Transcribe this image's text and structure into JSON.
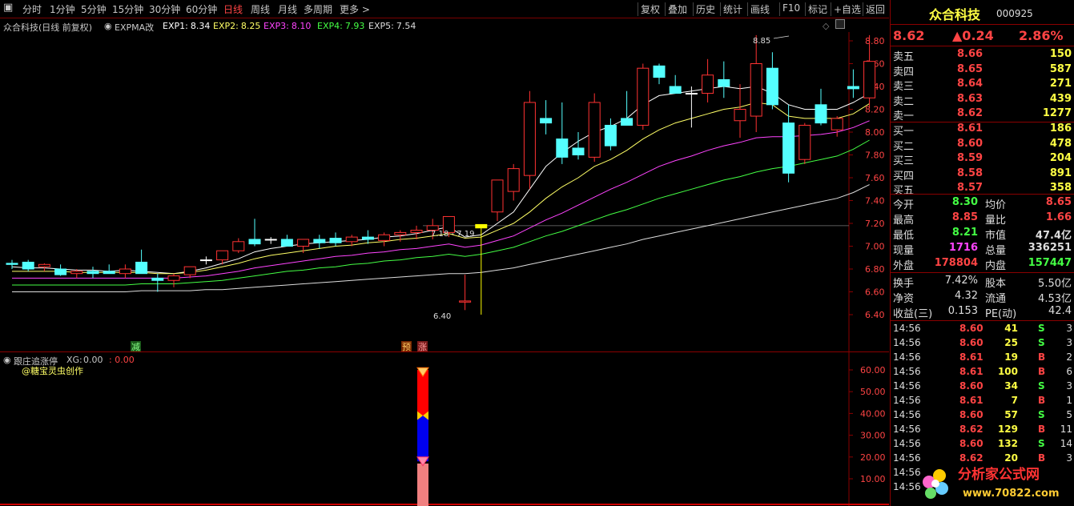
{
  "toolbar": {
    "periods": [
      "分时",
      "1分钟",
      "5分钟",
      "15分钟",
      "30分钟",
      "60分钟",
      "日线",
      "周线",
      "月线",
      "多周期",
      "更多 >"
    ],
    "active_period": "日线",
    "right_buttons": [
      "复权",
      "叠加",
      "历史",
      "统计",
      "画线",
      "F10",
      "标记",
      "+自选",
      "返回"
    ]
  },
  "main_chart": {
    "title": "众合科技(日线 前复权)",
    "indicator": "EXPMA改",
    "exps": [
      {
        "label": "EXP1:",
        "value": "8.34",
        "color": "#ffffff"
      },
      {
        "label": "EXP2:",
        "value": "8.25",
        "color": "#ffff66"
      },
      {
        "label": "EXP3:",
        "value": "8.10",
        "color": "#ff44ff"
      },
      {
        "label": "EXP4:",
        "value": "7.93",
        "color": "#44ff44"
      },
      {
        "label": "EXP5:",
        "value": "7.54",
        "color": "#dddddd"
      }
    ],
    "price_axis": [
      "8.80",
      "8.60",
      "8.40",
      "8.20",
      "8.00",
      "7.80",
      "7.60",
      "7.40",
      "7.20",
      "7.00",
      "6.80",
      "6.60",
      "6.40"
    ],
    "annotations": {
      "high_label": "8.85",
      "range_label": "7.18 - 7.19",
      "low_label": "6.40",
      "signal_jian": "减",
      "signal_yu": "预",
      "signal_zhang": "涨"
    }
  },
  "sub_chart": {
    "title": "跟庄追涨停",
    "xg_label": "XG:",
    "xg_value": "0.00",
    "xg_value2": "0.00",
    "credit": "@糖宝灵虫创作",
    "axis": [
      "60.00",
      "50.00",
      "40.00",
      "30.00",
      "20.00",
      "10.00"
    ]
  },
  "chart_data": {
    "type": "candlestick",
    "title": "众合科技(日线 前复权)",
    "ylim": [
      6.4,
      8.85
    ],
    "candles": [
      {
        "o": 6.85,
        "h": 6.88,
        "l": 6.8,
        "c": 6.84
      },
      {
        "o": 6.86,
        "h": 6.88,
        "l": 6.78,
        "c": 6.8
      },
      {
        "o": 6.82,
        "h": 6.85,
        "l": 6.78,
        "c": 6.84
      },
      {
        "o": 6.8,
        "h": 6.84,
        "l": 6.74,
        "c": 6.75
      },
      {
        "o": 6.76,
        "h": 6.8,
        "l": 6.72,
        "c": 6.78
      },
      {
        "o": 6.78,
        "h": 6.82,
        "l": 6.72,
        "c": 6.76
      },
      {
        "o": 6.78,
        "h": 6.84,
        "l": 6.76,
        "c": 6.76
      },
      {
        "o": 6.76,
        "h": 6.84,
        "l": 6.72,
        "c": 6.8
      },
      {
        "o": 6.86,
        "h": 6.97,
        "l": 6.8,
        "c": 6.76
      },
      {
        "o": 6.72,
        "h": 6.76,
        "l": 6.6,
        "c": 6.7
      },
      {
        "o": 6.7,
        "h": 6.76,
        "l": 6.64,
        "c": 6.74
      },
      {
        "o": 6.75,
        "h": 6.82,
        "l": 6.72,
        "c": 6.82
      },
      {
        "o": 6.88,
        "h": 6.91,
        "l": 6.84,
        "c": 6.88
      },
      {
        "o": 6.88,
        "h": 6.94,
        "l": 6.84,
        "c": 6.96
      },
      {
        "o": 6.96,
        "h": 7.07,
        "l": 6.94,
        "c": 7.04
      },
      {
        "o": 7.06,
        "h": 7.24,
        "l": 7.0,
        "c": 7.02
      },
      {
        "o": 7.06,
        "h": 7.08,
        "l": 7.02,
        "c": 7.06
      },
      {
        "o": 7.06,
        "h": 7.1,
        "l": 7.0,
        "c": 7.0
      },
      {
        "o": 7.0,
        "h": 7.06,
        "l": 6.94,
        "c": 7.06
      },
      {
        "o": 7.06,
        "h": 7.1,
        "l": 6.98,
        "c": 7.03
      },
      {
        "o": 7.07,
        "h": 7.12,
        "l": 7.0,
        "c": 7.03
      },
      {
        "o": 7.04,
        "h": 7.1,
        "l": 7.0,
        "c": 7.08
      },
      {
        "o": 7.08,
        "h": 7.14,
        "l": 7.02,
        "c": 7.06
      },
      {
        "o": 7.05,
        "h": 7.12,
        "l": 7.0,
        "c": 7.1
      },
      {
        "o": 7.1,
        "h": 7.14,
        "l": 7.04,
        "c": 7.12
      },
      {
        "o": 7.12,
        "h": 7.18,
        "l": 7.06,
        "c": 7.14
      },
      {
        "o": 7.14,
        "h": 7.24,
        "l": 7.06,
        "c": 7.18
      },
      {
        "o": 7.12,
        "h": 7.24,
        "l": 7.08,
        "c": 7.26
      },
      {
        "o": 6.51,
        "h": 6.75,
        "l": 6.44,
        "c": 6.52
      },
      {
        "o": 7.16,
        "h": 7.18,
        "l": 6.4,
        "c": 7.19
      },
      {
        "o": 7.3,
        "h": 7.58,
        "l": 7.22,
        "c": 7.58
      },
      {
        "o": 7.48,
        "h": 7.72,
        "l": 7.4,
        "c": 7.68
      },
      {
        "o": 7.62,
        "h": 8.36,
        "l": 7.5,
        "c": 8.26
      },
      {
        "o": 8.12,
        "h": 8.28,
        "l": 7.98,
        "c": 8.08
      },
      {
        "o": 7.94,
        "h": 8.26,
        "l": 7.72,
        "c": 7.78
      },
      {
        "o": 7.86,
        "h": 8.0,
        "l": 7.76,
        "c": 7.8
      },
      {
        "o": 7.78,
        "h": 8.34,
        "l": 7.74,
        "c": 8.26
      },
      {
        "o": 8.06,
        "h": 8.12,
        "l": 7.84,
        "c": 7.88
      },
      {
        "o": 8.12,
        "h": 8.36,
        "l": 8.06,
        "c": 8.06
      },
      {
        "o": 8.06,
        "h": 8.6,
        "l": 8.02,
        "c": 8.56
      },
      {
        "o": 8.58,
        "h": 8.6,
        "l": 8.42,
        "c": 8.48
      },
      {
        "o": 8.4,
        "h": 8.5,
        "l": 8.34,
        "c": 8.34
      },
      {
        "o": 8.34,
        "h": 8.4,
        "l": 8.04,
        "c": 8.34
      },
      {
        "o": 8.34,
        "h": 8.64,
        "l": 8.26,
        "c": 8.5
      },
      {
        "o": 8.46,
        "h": 8.62,
        "l": 8.3,
        "c": 8.4
      },
      {
        "o": 8.1,
        "h": 8.42,
        "l": 7.95,
        "c": 8.2
      },
      {
        "o": 8.14,
        "h": 8.85,
        "l": 8.0,
        "c": 8.6
      },
      {
        "o": 8.56,
        "h": 8.7,
        "l": 8.2,
        "c": 8.24
      },
      {
        "o": 8.08,
        "h": 8.24,
        "l": 7.56,
        "c": 7.64
      },
      {
        "o": 7.76,
        "h": 8.08,
        "l": 7.72,
        "c": 8.06
      },
      {
        "o": 8.24,
        "h": 8.38,
        "l": 8.06,
        "c": 8.08
      },
      {
        "o": 8.02,
        "h": 8.14,
        "l": 7.96,
        "c": 8.12
      },
      {
        "o": 8.4,
        "h": 8.55,
        "l": 8.3,
        "c": 8.38
      },
      {
        "o": 8.3,
        "h": 8.85,
        "l": 8.21,
        "c": 8.62
      }
    ],
    "series": [
      {
        "name": "EXP1",
        "color": "#ffffff",
        "values": [
          6.82,
          6.81,
          6.81,
          6.8,
          6.79,
          6.79,
          6.78,
          6.79,
          6.78,
          6.77,
          6.76,
          6.78,
          6.81,
          6.85,
          6.89,
          6.95,
          6.98,
          7.0,
          7.02,
          7.03,
          7.04,
          7.05,
          7.06,
          7.08,
          7.09,
          7.11,
          7.14,
          7.17,
          7.08,
          7.1,
          7.2,
          7.3,
          7.5,
          7.7,
          7.82,
          7.92,
          8.0,
          8.05,
          8.12,
          8.24,
          8.32,
          8.34,
          8.36,
          8.38,
          8.4,
          8.38,
          8.4,
          8.34,
          8.24,
          8.2,
          8.2,
          8.2,
          8.26,
          8.34
        ]
      },
      {
        "name": "EXP2",
        "color": "#ffff66",
        "values": [
          6.78,
          6.78,
          6.78,
          6.78,
          6.77,
          6.77,
          6.77,
          6.77,
          6.77,
          6.76,
          6.76,
          6.77,
          6.79,
          6.82,
          6.85,
          6.89,
          6.92,
          6.94,
          6.96,
          6.98,
          7.0,
          7.01,
          7.03,
          7.04,
          7.06,
          7.07,
          7.09,
          7.11,
          7.07,
          7.08,
          7.14,
          7.2,
          7.3,
          7.42,
          7.52,
          7.6,
          7.7,
          7.76,
          7.84,
          7.94,
          8.02,
          8.08,
          8.12,
          8.16,
          8.2,
          8.22,
          8.26,
          8.24,
          8.14,
          8.12,
          8.12,
          8.12,
          8.16,
          8.25
        ]
      },
      {
        "name": "EXP3",
        "color": "#ff44ff",
        "values": [
          6.72,
          6.72,
          6.72,
          6.72,
          6.72,
          6.72,
          6.72,
          6.72,
          6.72,
          6.72,
          6.72,
          6.73,
          6.74,
          6.76,
          6.78,
          6.81,
          6.83,
          6.85,
          6.87,
          6.89,
          6.91,
          6.92,
          6.94,
          6.95,
          6.97,
          6.98,
          7.0,
          7.02,
          6.99,
          7.01,
          7.05,
          7.09,
          7.16,
          7.23,
          7.29,
          7.36,
          7.43,
          7.5,
          7.56,
          7.63,
          7.7,
          7.75,
          7.79,
          7.84,
          7.88,
          7.91,
          7.95,
          7.96,
          7.96,
          7.97,
          7.98,
          8.0,
          8.04,
          8.1
        ]
      },
      {
        "name": "EXP4",
        "color": "#44ff44",
        "values": [
          6.66,
          6.66,
          6.66,
          6.66,
          6.66,
          6.66,
          6.66,
          6.66,
          6.67,
          6.67,
          6.67,
          6.68,
          6.69,
          6.7,
          6.72,
          6.74,
          6.76,
          6.78,
          6.79,
          6.81,
          6.82,
          6.84,
          6.85,
          6.87,
          6.88,
          6.9,
          6.91,
          6.93,
          6.91,
          6.93,
          6.96,
          6.99,
          7.04,
          7.09,
          7.13,
          7.18,
          7.23,
          7.28,
          7.32,
          7.37,
          7.42,
          7.46,
          7.5,
          7.54,
          7.58,
          7.61,
          7.65,
          7.68,
          7.7,
          7.73,
          7.76,
          7.79,
          7.85,
          7.93
        ]
      },
      {
        "name": "EXP5",
        "color": "#dddddd",
        "values": [
          6.6,
          6.6,
          6.6,
          6.6,
          6.6,
          6.6,
          6.6,
          6.6,
          6.61,
          6.61,
          6.61,
          6.61,
          6.62,
          6.62,
          6.63,
          6.64,
          6.65,
          6.66,
          6.67,
          6.68,
          6.69,
          6.7,
          6.71,
          6.72,
          6.73,
          6.74,
          6.75,
          6.76,
          6.76,
          6.77,
          6.79,
          6.81,
          6.84,
          6.87,
          6.9,
          6.93,
          6.96,
          6.99,
          7.02,
          7.06,
          7.09,
          7.12,
          7.15,
          7.18,
          7.21,
          7.24,
          7.27,
          7.3,
          7.33,
          7.36,
          7.39,
          7.42,
          7.47,
          7.54
        ]
      }
    ]
  },
  "quote": {
    "stock_name": "众合科技",
    "stock_code": "000925",
    "price": "8.62",
    "change": "▲0.24",
    "change_pct": "2.86%",
    "sell": [
      {
        "label": "卖五",
        "price": "8.66",
        "vol": "150"
      },
      {
        "label": "卖四",
        "price": "8.65",
        "vol": "587"
      },
      {
        "label": "卖三",
        "price": "8.64",
        "vol": "271"
      },
      {
        "label": "卖二",
        "price": "8.63",
        "vol": "439"
      },
      {
        "label": "卖一",
        "price": "8.62",
        "vol": "1277"
      }
    ],
    "buy": [
      {
        "label": "买一",
        "price": "8.61",
        "vol": "186"
      },
      {
        "label": "买二",
        "price": "8.60",
        "vol": "478"
      },
      {
        "label": "买三",
        "price": "8.59",
        "vol": "204"
      },
      {
        "label": "买四",
        "price": "8.58",
        "vol": "891"
      },
      {
        "label": "买五",
        "price": "8.57",
        "vol": "358"
      }
    ],
    "stats": [
      {
        "l1": "今开",
        "v1": "8.30",
        "c1": "#44ff44",
        "l2": "均价",
        "v2": "8.65",
        "c2": "#ff4444"
      },
      {
        "l1": "最高",
        "v1": "8.85",
        "c1": "#ff4444",
        "l2": "量比",
        "v2": "1.66",
        "c2": "#ff4444"
      },
      {
        "l1": "最低",
        "v1": "8.21",
        "c1": "#44ff44",
        "l2": "市值",
        "v2": "47.4亿",
        "c2": "#dddddd"
      },
      {
        "l1": "现量",
        "v1": "1716",
        "c1": "#ff44ff",
        "l2": "总量",
        "v2": "336251",
        "c2": "#dddddd"
      },
      {
        "l1": "外盘",
        "v1": "178804",
        "c1": "#ff4444",
        "l2": "内盘",
        "v2": "157447",
        "c2": "#44ff44"
      }
    ],
    "fund": [
      {
        "l1": "换手",
        "v1": "7.42%",
        "l2": "股本",
        "v2": "5.50亿"
      },
      {
        "l1": "净资",
        "v1": "4.32",
        "l2": "流通",
        "v2": "4.53亿"
      },
      {
        "l1": "收益(三)",
        "v1": "0.153",
        "l2": "PE(动)",
        "v2": "42.4"
      }
    ],
    "ticks": [
      {
        "time": "14:56",
        "price": "8.60",
        "vol": "41",
        "side": "S",
        "n": "3"
      },
      {
        "time": "14:56",
        "price": "8.60",
        "vol": "25",
        "side": "S",
        "n": "3"
      },
      {
        "time": "14:56",
        "price": "8.61",
        "vol": "19",
        "side": "B",
        "n": "2"
      },
      {
        "time": "14:56",
        "price": "8.61",
        "vol": "100",
        "side": "B",
        "n": "6"
      },
      {
        "time": "14:56",
        "price": "8.60",
        "vol": "34",
        "side": "S",
        "n": "3"
      },
      {
        "time": "14:56",
        "price": "8.61",
        "vol": "7",
        "side": "B",
        "n": "1"
      },
      {
        "time": "14:56",
        "price": "8.60",
        "vol": "57",
        "side": "S",
        "n": "5"
      },
      {
        "time": "14:56",
        "price": "8.62",
        "vol": "129",
        "side": "B",
        "n": "11"
      },
      {
        "time": "14:56",
        "price": "8.60",
        "vol": "132",
        "side": "S",
        "n": "14"
      },
      {
        "time": "14:56",
        "price": "8.62",
        "vol": "20",
        "side": "B",
        "n": "3"
      },
      {
        "time": "14:56",
        "price": "",
        "vol": "",
        "side": "",
        "n": ""
      },
      {
        "time": "14:56",
        "price": "",
        "vol": "",
        "side": "",
        "n": ""
      }
    ]
  },
  "watermark": {
    "name": "分析家公式网",
    "url": "www.70822.com"
  }
}
